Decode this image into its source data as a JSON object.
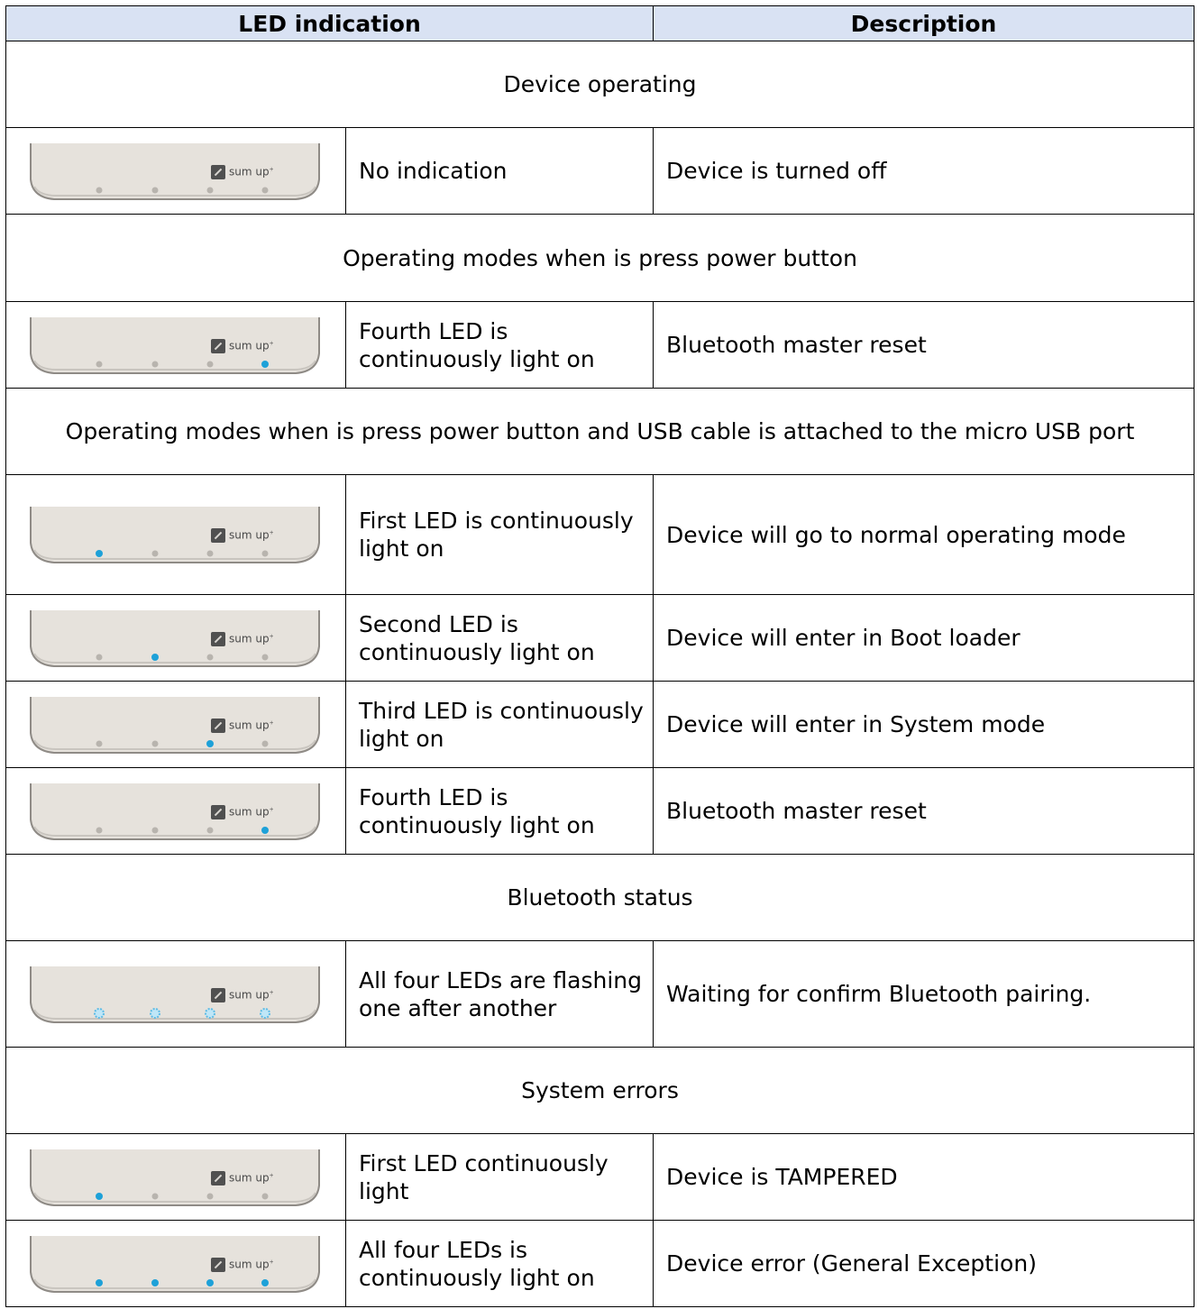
{
  "header": {
    "col1": "LED indication",
    "col2": "Description"
  },
  "logo_text": "sum up",
  "logo_mark": "+",
  "colors": {
    "led_off": "#b8b4ae",
    "led_on": "#1ea1d8",
    "header_bg": "#d9e2f3",
    "device_body": "#e6e2dc"
  },
  "sections": [
    {
      "title": "Device operating",
      "rows": [
        {
          "leds": [
            "off",
            "off",
            "off",
            "off"
          ],
          "indication": "No indication",
          "description": "Device is turned off"
        }
      ]
    },
    {
      "title": "Operating modes when is press power button",
      "rows": [
        {
          "leds": [
            "off",
            "off",
            "off",
            "on"
          ],
          "indication": "Fourth LED is continuously  light on",
          "description": "Bluetooth master reset"
        }
      ]
    },
    {
      "title": "Operating modes when is press power button and USB cable is attached to the micro USB port",
      "rows": [
        {
          "leds": [
            "on",
            "off",
            "off",
            "off"
          ],
          "indication": "First LED is continuously light on",
          "description": "Device will go to normal operating mode"
        },
        {
          "leds": [
            "off",
            "on",
            "off",
            "off"
          ],
          "indication": "Second LED is continuously light on",
          "description": "Device will enter in Boot loader"
        },
        {
          "leds": [
            "off",
            "off",
            "on",
            "off"
          ],
          "indication": "Third LED is continuously light on",
          "description": "Device will enter in System mode"
        },
        {
          "leds": [
            "off",
            "off",
            "off",
            "on"
          ],
          "indication": "Fourth LED is continuously  light on",
          "description": "Bluetooth master reset"
        }
      ]
    },
    {
      "title": "Bluetooth status",
      "rows": [
        {
          "leds": [
            "flash",
            "flash",
            "flash",
            "flash"
          ],
          "indication": "All four LEDs are flashing one after another",
          "description": "Waiting for confirm Bluetooth pairing."
        }
      ]
    },
    {
      "title": "System errors",
      "rows": [
        {
          "leds": [
            "on",
            "off",
            "off",
            "off"
          ],
          "indication": "First LED continuously light",
          "description": "Device is TAMPERED"
        },
        {
          "leds": [
            "on",
            "on",
            "on",
            "on"
          ],
          "indication": "All four LEDs is continuously light on",
          "description": "Device error (General Exception)"
        }
      ]
    }
  ]
}
